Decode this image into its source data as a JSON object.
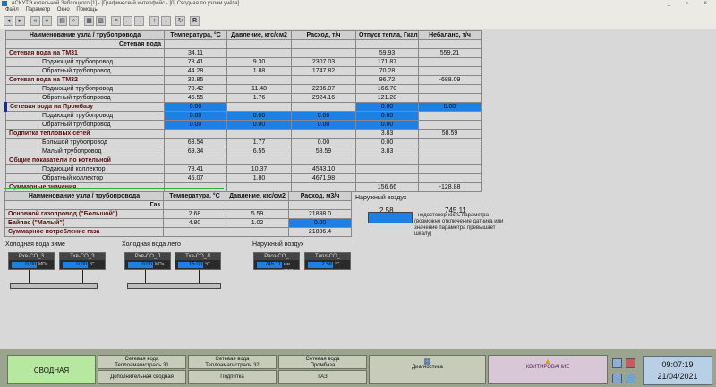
{
  "window": {
    "title": "АСКУТЭ котельной Заблоцкого [1] - [Графический интерфейс - [0] Сводная по узлам учёта]",
    "menu": [
      "Файл",
      "Параметр",
      "Окно",
      "Помощь"
    ]
  },
  "toolbar": {
    "r_label": "R"
  },
  "table1": {
    "headers": [
      "Наименование узла / трубопровода",
      "Температура, °C",
      "Давление, кгс/см2",
      "Расход, т/ч",
      "Отпуск тепла, Гкал/ч",
      "Небаланс, т/ч"
    ],
    "rows": [
      {
        "name": "Сетевая вода",
        "vals": [
          "",
          "",
          "",
          "",
          ""
        ],
        "type": "section"
      },
      {
        "name": "Сетевая вода на ТМ31",
        "vals": [
          "34.11",
          "",
          "",
          "59.93",
          "559.21"
        ],
        "type": "group"
      },
      {
        "name": "Подающий трубопровод",
        "vals": [
          "78.41",
          "9.30",
          "2307.03",
          "171.87",
          ""
        ],
        "type": "sub"
      },
      {
        "name": "Обратный трубопровод",
        "vals": [
          "44.28",
          "1.88",
          "1747.82",
          "70.28",
          ""
        ],
        "type": "sub"
      },
      {
        "name": "Сетевая вода на ТМ32",
        "vals": [
          "32.85",
          "",
          "",
          "96.72",
          "-688.09"
        ],
        "type": "group"
      },
      {
        "name": "Подающий трубопровод",
        "vals": [
          "78.42",
          "11.48",
          "2236.07",
          "166.70",
          ""
        ],
        "type": "sub"
      },
      {
        "name": "Обратный трубопровод",
        "vals": [
          "45.55",
          "1.76",
          "2924.16",
          "121.28",
          ""
        ],
        "type": "sub"
      },
      {
        "name": "Сетевая вода на Промбазу",
        "vals": [
          "0.00",
          "",
          "",
          "0.00",
          "0.00"
        ],
        "type": "group",
        "blue": [
          1,
          4,
          5
        ]
      },
      {
        "name": "Подающий трубопровод",
        "vals": [
          "0.00",
          "0.00",
          "0.00",
          "0.00",
          ""
        ],
        "type": "sub",
        "blue": [
          1,
          2,
          3,
          4
        ]
      },
      {
        "name": "Обратный трубопровод",
        "vals": [
          "0.00",
          "0.00",
          "0.00",
          "0.00",
          ""
        ],
        "type": "sub",
        "blue": [
          1,
          2,
          3,
          4
        ]
      },
      {
        "name": "Подпитка тепловых сетей",
        "vals": [
          "",
          "",
          "",
          "3.83",
          "58.59"
        ],
        "type": "group"
      },
      {
        "name": "Большой трубопровод",
        "vals": [
          "68.54",
          "1.77",
          "0.00",
          "0.00",
          ""
        ],
        "type": "sub"
      },
      {
        "name": "Малый трубопровод",
        "vals": [
          "69.34",
          "6.55",
          "58.59",
          "3.83",
          ""
        ],
        "type": "sub"
      },
      {
        "name": "Общие показатели по котельной",
        "vals": [
          "",
          "",
          "",
          "",
          ""
        ],
        "type": "group"
      },
      {
        "name": "Подающий коллектор",
        "vals": [
          "78.41",
          "10.37",
          "4543.10",
          "",
          ""
        ],
        "type": "sub"
      },
      {
        "name": "Обратный коллектор",
        "vals": [
          "45.07",
          "1.80",
          "4671.98",
          "",
          ""
        ],
        "type": "sub"
      },
      {
        "name": "Суммарные значения",
        "vals": [
          "",
          "",
          "",
          "156.66",
          "-128.88"
        ],
        "type": "group"
      }
    ]
  },
  "table2": {
    "headers": [
      "Наименование узла / трубопровода",
      "Температура, °C",
      "Давление, кгс/см2",
      "Расход, м3/ч"
    ],
    "rows": [
      {
        "name": "Газ",
        "vals": [
          "",
          "",
          ""
        ],
        "type": "section"
      },
      {
        "name": "Основной газопровод (\"Большой\")",
        "vals": [
          "2.68",
          "5.59",
          "21838.0"
        ],
        "type": "group"
      },
      {
        "name": "Байпас (\"Малый\")",
        "vals": [
          "4.80",
          "1.02",
          "0.00"
        ],
        "type": "group",
        "blue": [
          3
        ]
      },
      {
        "name": "Суммарное потребление газа",
        "vals": [
          "",
          "",
          "21836.4"
        ],
        "type": "group"
      }
    ]
  },
  "outdoor": {
    "title": "Наружный воздух",
    "value1": "2.58",
    "value2": "745.11"
  },
  "legend": {
    "text": "- недостоверность параметра (возможно отключение датчика или значение параметра превышает шкалу)"
  },
  "diagrams": {
    "cold_winter": {
      "title": "Холодная вода зиме",
      "g1": {
        "tag": "Рхв-CO_З",
        "value": "0.00",
        "unit": "МПа"
      },
      "g2": {
        "tag": "Тхв-CO_З",
        "value": "0.00",
        "unit": "°C"
      }
    },
    "cold_summer": {
      "title": "Холодная вода лето",
      "g1": {
        "tag": "Рхв-CO_Л",
        "value": "0.00",
        "unit": "МПа"
      },
      "g2": {
        "tag": "Тхв-CO_Л",
        "value": "15.00",
        "unit": "°C"
      }
    },
    "outdoor_air": {
      "title": "Наружный воздух",
      "g1": {
        "tag": "Рвоз-CO_",
        "value": "745.11",
        "unit": "мм рт.ст"
      },
      "g2": {
        "tag": "Тнпл-CO_",
        "value": "2.58",
        "unit": "°C"
      }
    }
  },
  "nav": {
    "main": "СВОДНАЯ",
    "btn1_top": "Сетевая вода\nТеплоамагистраль 31",
    "btn1_bottom": "Дополнительная сводная",
    "btn2_top": "Сетевая вода\nТеплоамагистраль 32",
    "btn2_bottom": "Подпитка",
    "btn3_top": "Сетевая вода\nПромбаза",
    "btn3_bottom": "ГАЗ",
    "btn4_bottom": "Диагностика",
    "btn5_bottom": "КВИТИРОВАНИЕ"
  },
  "clock": {
    "time": "09:07:19",
    "date": "21/04/2021"
  }
}
